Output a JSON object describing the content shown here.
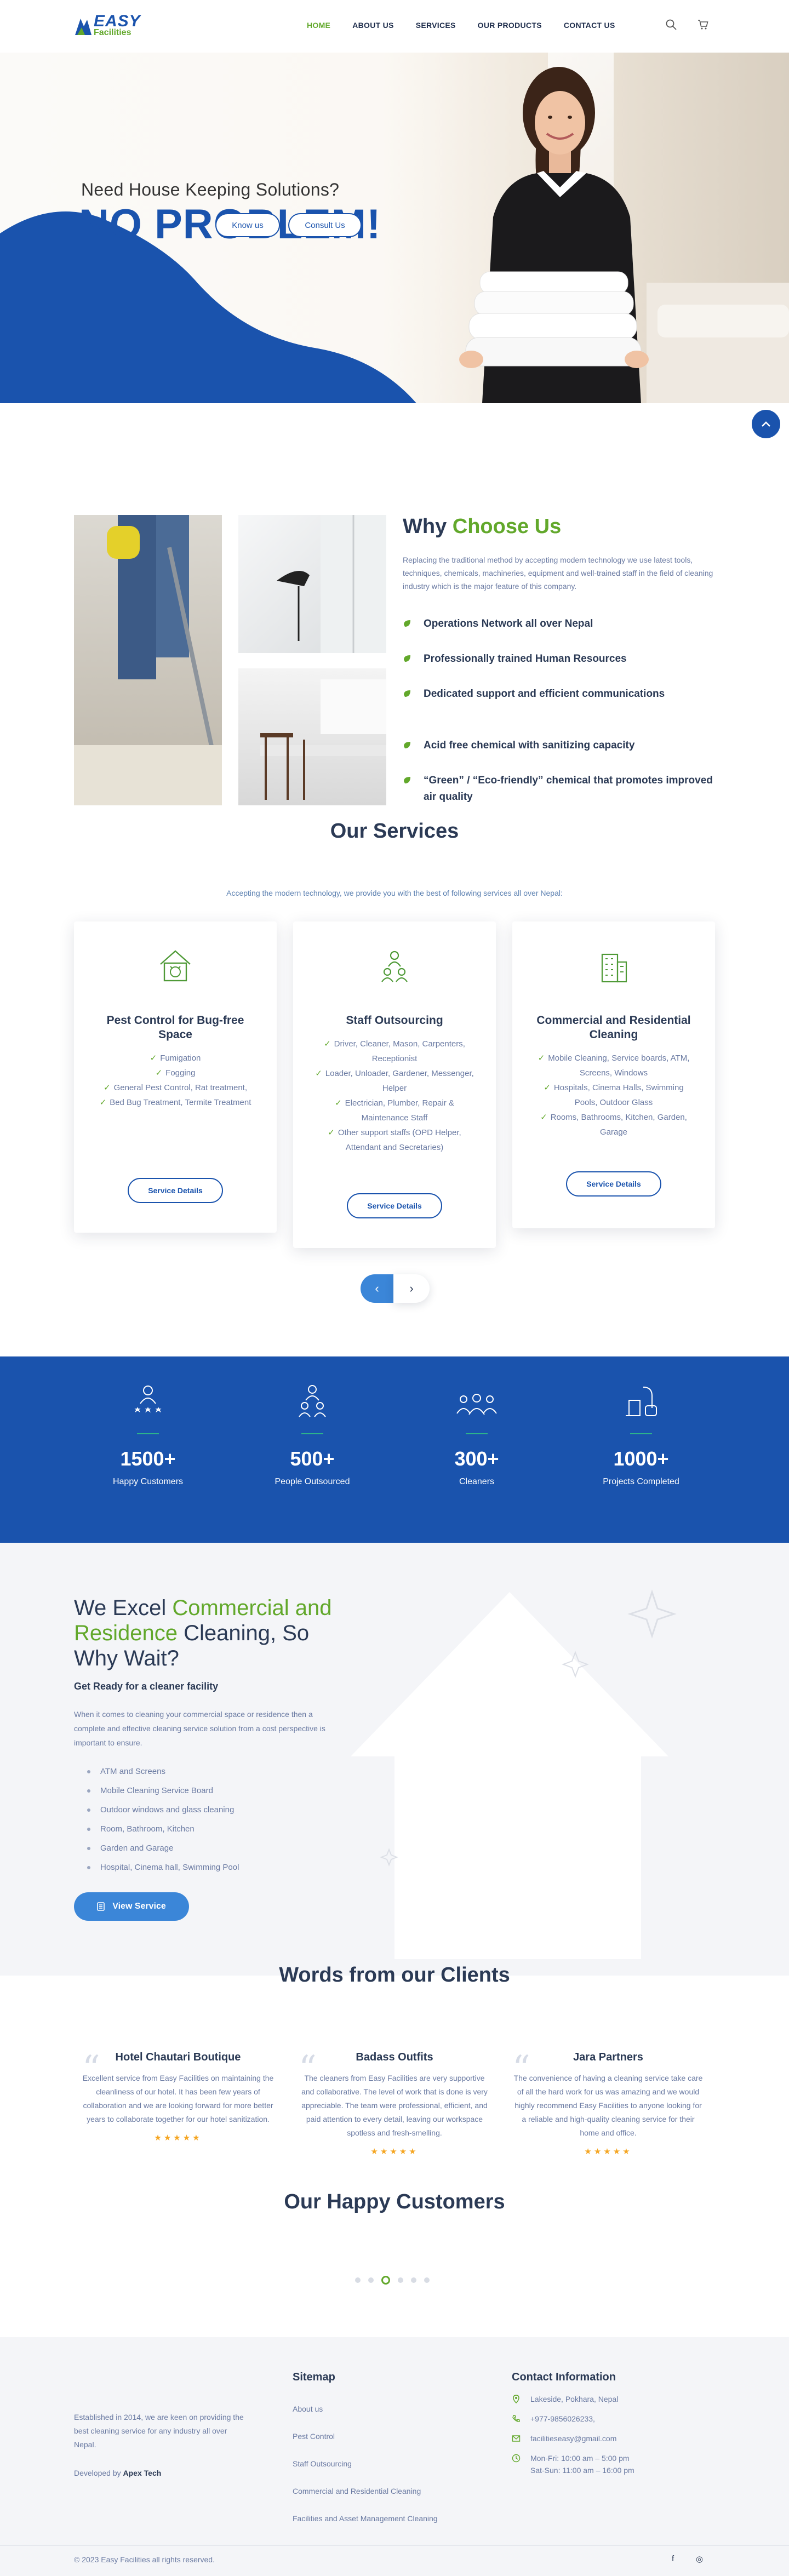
{
  "brand": {
    "logo_top": "EASY",
    "logo_bottom": "Facilities",
    "colors": {
      "primary": "#1a53ad",
      "accent": "#62a82b",
      "light_blue": "#3b86d8"
    }
  },
  "nav": {
    "items": [
      {
        "label": "HOME",
        "active": true
      },
      {
        "label": "ABOUT US"
      },
      {
        "label": "SERVICES"
      },
      {
        "label": "OUR PRODUCTS"
      },
      {
        "label": "CONTACT US"
      }
    ],
    "icons": [
      "search-icon",
      "cart-icon"
    ]
  },
  "hero": {
    "subtitle": "Need House Keeping Solutions?",
    "title": "NO PROBLEM!",
    "btn_know": "Know us",
    "btn_consult": "Consult Us"
  },
  "why": {
    "title_a": "Why ",
    "title_b": "Choose Us",
    "desc": "Replacing the traditional method by accepting modern technology we use latest tools, techniques, chemicals, machineries, equipment and well-trained staff in the field of cleaning industry which is the major feature of this company.",
    "points": [
      "Operations Network all over Nepal",
      "Professionally trained Human Resources",
      "Dedicated support and efficient communications",
      "Acid free chemical with sanitizing capacity",
      "“Green” / “Eco-friendly” chemical that promotes improved air quality"
    ]
  },
  "services": {
    "title": "Our Services",
    "intro": "Accepting the modern technology, we provide you with the best of following services all over Nepal:",
    "cards": [
      {
        "title": "Pest Control for Bug-free Space",
        "items": [
          "Fumigation",
          "Fogging",
          "General Pest Control, Rat treatment,",
          "Bed Bug Treatment, Termite Treatment"
        ],
        "btn": "Service Details"
      },
      {
        "title": "Staff Outsourcing",
        "items": [
          "Driver, Cleaner, Mason, Carpenters, Receptionist",
          "Loader, Unloader, Gardener, Messenger, Helper",
          "Electrician, Plumber, Repair & Maintenance Staff",
          "Other support staffs (OPD Helper, Attendant and Secretaries)"
        ],
        "btn": "Service Details"
      },
      {
        "title": "Commercial and Residential Cleaning",
        "items": [
          "Mobile Cleaning, Service boards, ATM, Screens, Windows",
          "Hospitals, Cinema Halls, Swimming Pools, Outdoor Glass",
          "Rooms, Bathrooms, Kitchen, Garden, Garage"
        ],
        "btn": "Service Details"
      }
    ],
    "prev": "‹",
    "next": "›"
  },
  "stats": [
    {
      "num": "1500+",
      "label": "Happy Customers"
    },
    {
      "num": "500+",
      "label": "People Outsourced"
    },
    {
      "num": "300+",
      "label": "Cleaners"
    },
    {
      "num": "1000+",
      "label": "Projects Completed"
    }
  ],
  "excel": {
    "title_a": "We Excel ",
    "title_b": "Commercial and Residence",
    "title_c": " Cleaning, So Why Wait?",
    "subtitle": "Get Ready for a cleaner facility",
    "para": "When it comes to cleaning your commercial space or residence then a complete and effective cleaning service solution from a cost perspective is important to ensure.",
    "items": [
      "ATM and Screens",
      "Mobile Cleaning Service Board",
      "Outdoor windows and glass cleaning",
      "Room, Bathroom, Kitchen",
      "Garden and Garage",
      "Hospital, Cinema hall, Swimming Pool"
    ],
    "btn": "View Service"
  },
  "clients": {
    "title": "Words from our Clients",
    "items": [
      {
        "name": "Hotel Chautari Boutique",
        "text": "Excellent service from Easy Facilities on maintaining the cleanliness of our hotel. It has been few years of collaboration and we are looking forward for more better years to collaborate together for our hotel sanitization.",
        "stars": "★★★★★"
      },
      {
        "name": "Badass Outfits",
        "text": "The cleaners from Easy Facilities are very supportive and collaborative. The level of work that is done is very appreciable. The team were professional, efficient, and paid attention to every detail, leaving our workspace spotless and fresh-smelling.",
        "stars": "★★★★★"
      },
      {
        "name": "Jara Partners",
        "text": "The convenience of having a cleaning service take care of all the hard work for us was amazing and we would highly recommend Easy Facilities to anyone looking for a reliable and high-quality cleaning service for their home and office.",
        "stars": "★★★★★"
      }
    ]
  },
  "customers": {
    "title": "Our Happy Customers"
  },
  "footer": {
    "about": "Established in 2014, we are keen on providing the best cleaning service for any industry all over Nepal.",
    "dev_prefix": "Developed by ",
    "dev_name": "Apex Tech",
    "sitemap_title": "Sitemap",
    "sitemap": [
      "About us",
      "Pest Control",
      "Staff Outsourcing",
      "Commercial and Residential Cleaning",
      "Facilities and Asset Management Cleaning"
    ],
    "contact_title": "Contact Information",
    "address": "Lakeside, Pokhara, Nepal",
    "phone": "+977-9856026233,",
    "email": "facilitieseasy@gmail.com",
    "hours_1": "Mon-Fri: 10:00 am – 5:00 pm",
    "hours_2": "Sat-Sun: 11:00 am – 16:00 pm",
    "copyright": "© 2023 Easy Facilities all rights reserved.",
    "social": [
      "f",
      "◎"
    ]
  }
}
